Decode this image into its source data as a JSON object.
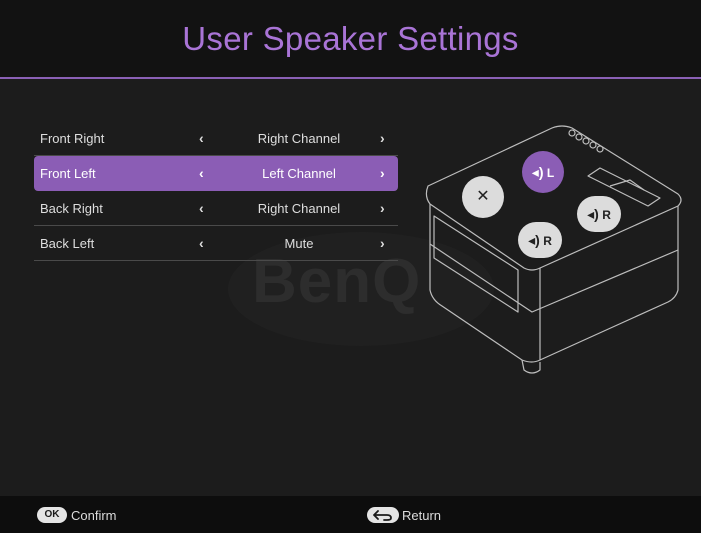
{
  "header": {
    "title": "User Speaker Settings"
  },
  "watermark": {
    "text": "BenQ"
  },
  "menu": {
    "rows": [
      {
        "label": "Front Right",
        "value": "Right Channel",
        "selected": false
      },
      {
        "label": "Front Left",
        "value": "Left Channel",
        "selected": true
      },
      {
        "label": "Back Right",
        "value": "Right Channel",
        "selected": false
      },
      {
        "label": "Back Left",
        "value": "Mute",
        "selected": false
      }
    ],
    "arrow_left": "‹",
    "arrow_right": "›"
  },
  "diagram": {
    "speakers": [
      {
        "name": "front-left",
        "label": "L",
        "state": "selected"
      },
      {
        "name": "front-right",
        "label": "",
        "state": "mute"
      },
      {
        "name": "back-right",
        "label": "R",
        "state": "normal"
      },
      {
        "name": "back-left",
        "label": "R",
        "state": "normal"
      }
    ]
  },
  "footer": {
    "ok_badge": "OK",
    "confirm_label": "Confirm",
    "return_label": "Return"
  },
  "colors": {
    "accent": "#8b5db5",
    "title": "#a974d6",
    "background": "#1c1c1c"
  }
}
